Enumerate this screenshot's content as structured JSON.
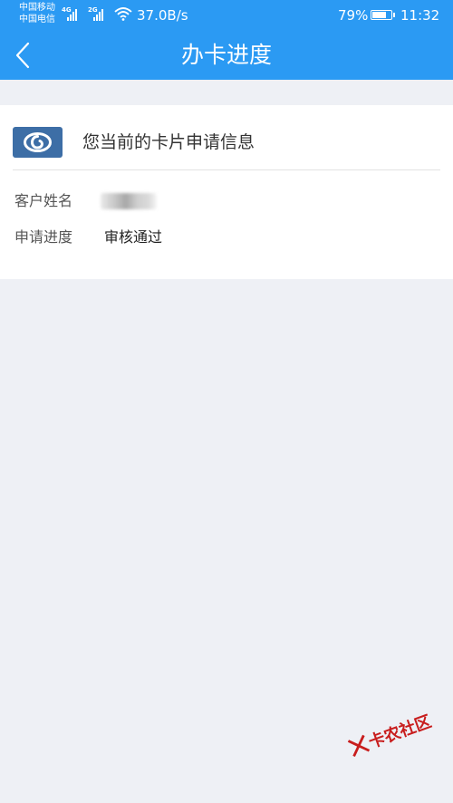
{
  "statusbar": {
    "carrier1": "中国移动",
    "carrier2": "中国电信",
    "net1": "4G",
    "net2": "2G",
    "speed": "37.0B/s",
    "battery": "79%",
    "battery_level": 0.79,
    "time": "11:32"
  },
  "navbar": {
    "title": "办卡进度",
    "back_icon": "chevron-left-icon"
  },
  "card": {
    "logo_icon": "bank-logo-icon",
    "title": "您当前的卡片申请信息",
    "rows": [
      {
        "label": "客户姓名",
        "value": ""
      },
      {
        "label": "申请进度",
        "value": "审核通过"
      }
    ]
  },
  "watermark": {
    "text": "卡农社区",
    "color": "#c81d1d"
  },
  "colors": {
    "header": "#2b9af3",
    "background": "#eef0f5",
    "logo": "#3d6ea6"
  }
}
